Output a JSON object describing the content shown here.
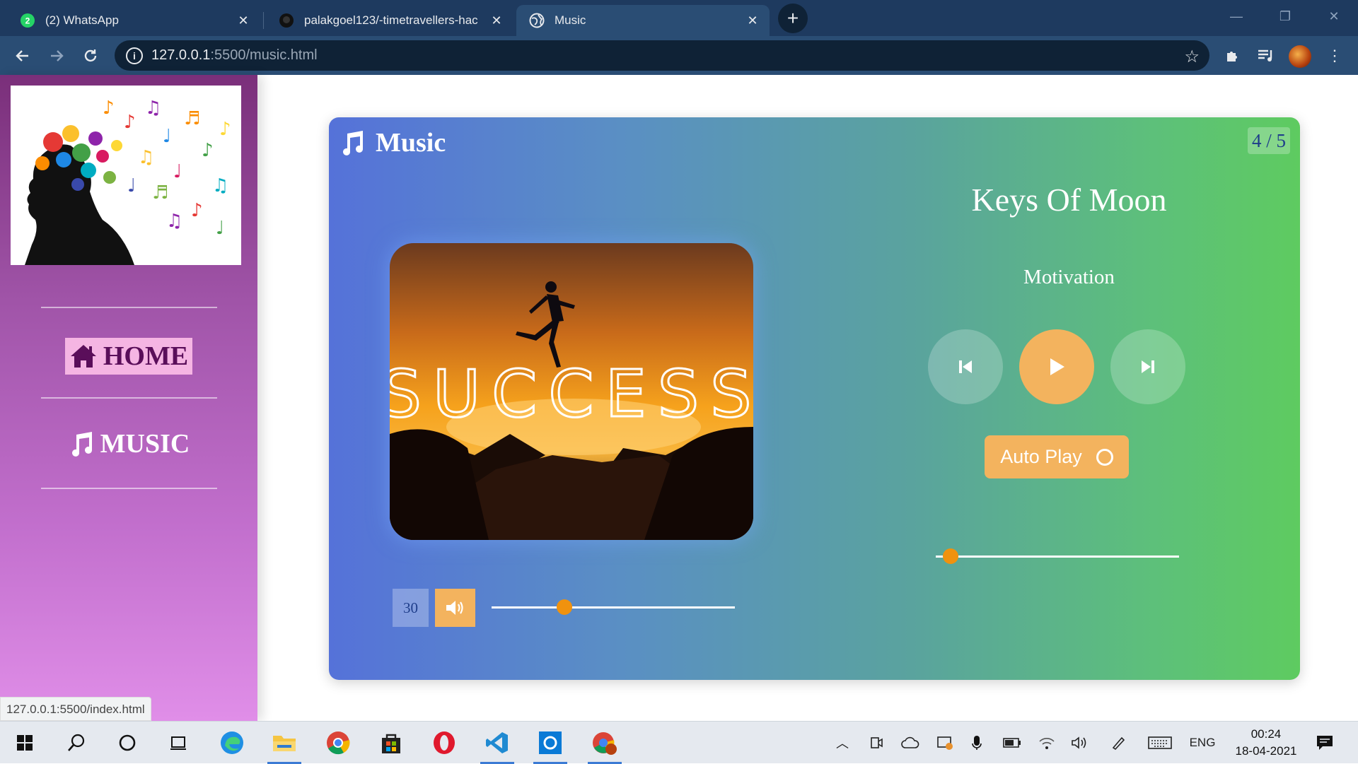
{
  "browser": {
    "tabs": [
      {
        "title": "(2) WhatsApp",
        "icon": "whatsapp-icon",
        "badge": "2"
      },
      {
        "title": "palakgoel123/-timetravellers-hac",
        "icon": "github-icon"
      },
      {
        "title": "Music",
        "icon": "globe-icon",
        "active": true
      }
    ],
    "url_host": "127.0.0.1",
    "url_rest": ":5500/music.html",
    "status_url": "127.0.0.1:5500/index.html"
  },
  "sidebar": {
    "home_label": "HOME",
    "music_label": "MUSIC"
  },
  "player": {
    "brand": "Music",
    "counter": "4 / 5",
    "song_title": "Keys Of Moon",
    "song_artist": "Motivation",
    "cover_text": "SUCCESS",
    "autoplay_label": "Auto Play",
    "volume_value": "30",
    "volume_fraction": 0.3,
    "progress_fraction": 0.06
  },
  "taskbar": {
    "language": "ENG",
    "time": "00:24",
    "date": "18-04-2021"
  },
  "colors": {
    "accent": "#f3b35e",
    "thumb": "#f0920e",
    "tabstrip": "#1e3a5f"
  }
}
